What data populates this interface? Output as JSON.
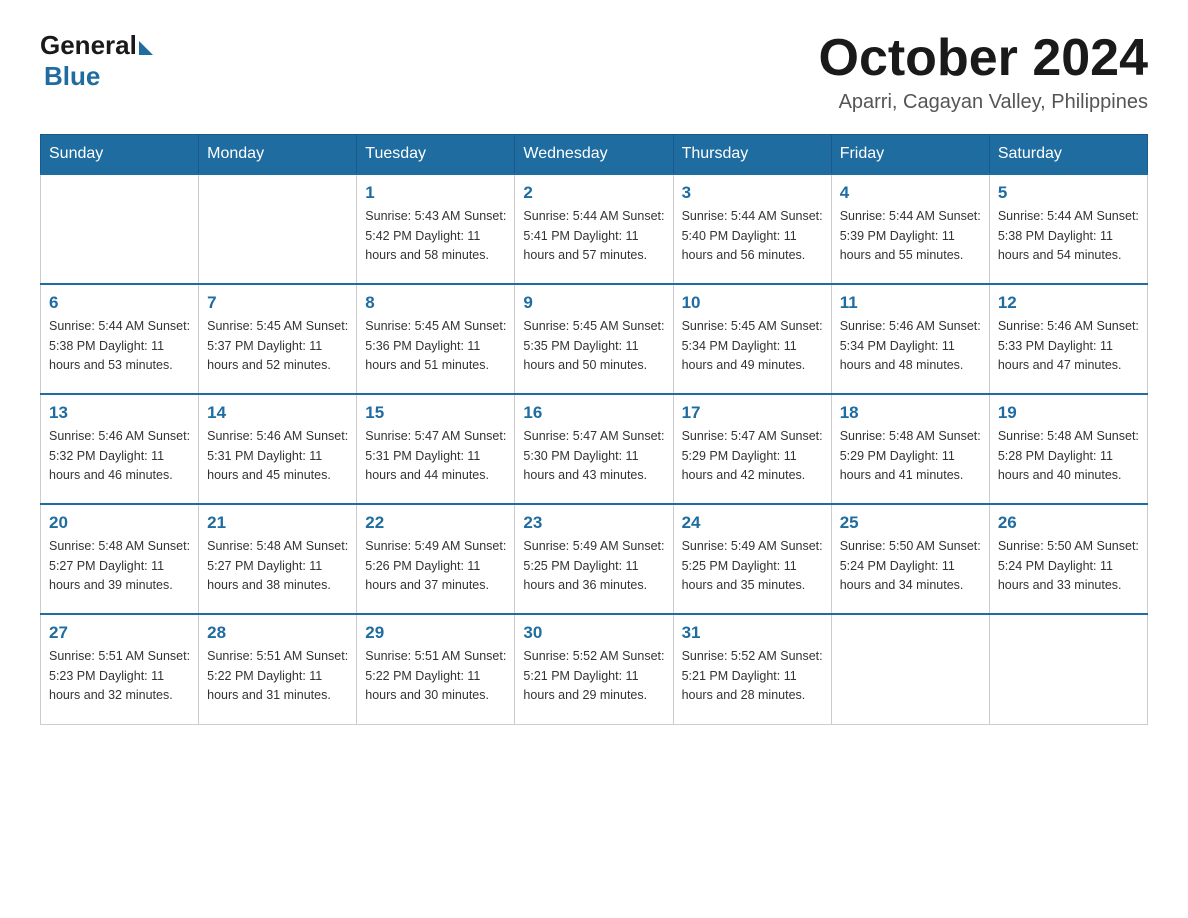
{
  "header": {
    "logo_general": "General",
    "logo_blue": "Blue",
    "month_title": "October 2024",
    "location": "Aparri, Cagayan Valley, Philippines"
  },
  "days_of_week": [
    "Sunday",
    "Monday",
    "Tuesday",
    "Wednesday",
    "Thursday",
    "Friday",
    "Saturday"
  ],
  "weeks": [
    [
      {
        "day": "",
        "info": ""
      },
      {
        "day": "",
        "info": ""
      },
      {
        "day": "1",
        "info": "Sunrise: 5:43 AM\nSunset: 5:42 PM\nDaylight: 11 hours\nand 58 minutes."
      },
      {
        "day": "2",
        "info": "Sunrise: 5:44 AM\nSunset: 5:41 PM\nDaylight: 11 hours\nand 57 minutes."
      },
      {
        "day": "3",
        "info": "Sunrise: 5:44 AM\nSunset: 5:40 PM\nDaylight: 11 hours\nand 56 minutes."
      },
      {
        "day": "4",
        "info": "Sunrise: 5:44 AM\nSunset: 5:39 PM\nDaylight: 11 hours\nand 55 minutes."
      },
      {
        "day": "5",
        "info": "Sunrise: 5:44 AM\nSunset: 5:38 PM\nDaylight: 11 hours\nand 54 minutes."
      }
    ],
    [
      {
        "day": "6",
        "info": "Sunrise: 5:44 AM\nSunset: 5:38 PM\nDaylight: 11 hours\nand 53 minutes."
      },
      {
        "day": "7",
        "info": "Sunrise: 5:45 AM\nSunset: 5:37 PM\nDaylight: 11 hours\nand 52 minutes."
      },
      {
        "day": "8",
        "info": "Sunrise: 5:45 AM\nSunset: 5:36 PM\nDaylight: 11 hours\nand 51 minutes."
      },
      {
        "day": "9",
        "info": "Sunrise: 5:45 AM\nSunset: 5:35 PM\nDaylight: 11 hours\nand 50 minutes."
      },
      {
        "day": "10",
        "info": "Sunrise: 5:45 AM\nSunset: 5:34 PM\nDaylight: 11 hours\nand 49 minutes."
      },
      {
        "day": "11",
        "info": "Sunrise: 5:46 AM\nSunset: 5:34 PM\nDaylight: 11 hours\nand 48 minutes."
      },
      {
        "day": "12",
        "info": "Sunrise: 5:46 AM\nSunset: 5:33 PM\nDaylight: 11 hours\nand 47 minutes."
      }
    ],
    [
      {
        "day": "13",
        "info": "Sunrise: 5:46 AM\nSunset: 5:32 PM\nDaylight: 11 hours\nand 46 minutes."
      },
      {
        "day": "14",
        "info": "Sunrise: 5:46 AM\nSunset: 5:31 PM\nDaylight: 11 hours\nand 45 minutes."
      },
      {
        "day": "15",
        "info": "Sunrise: 5:47 AM\nSunset: 5:31 PM\nDaylight: 11 hours\nand 44 minutes."
      },
      {
        "day": "16",
        "info": "Sunrise: 5:47 AM\nSunset: 5:30 PM\nDaylight: 11 hours\nand 43 minutes."
      },
      {
        "day": "17",
        "info": "Sunrise: 5:47 AM\nSunset: 5:29 PM\nDaylight: 11 hours\nand 42 minutes."
      },
      {
        "day": "18",
        "info": "Sunrise: 5:48 AM\nSunset: 5:29 PM\nDaylight: 11 hours\nand 41 minutes."
      },
      {
        "day": "19",
        "info": "Sunrise: 5:48 AM\nSunset: 5:28 PM\nDaylight: 11 hours\nand 40 minutes."
      }
    ],
    [
      {
        "day": "20",
        "info": "Sunrise: 5:48 AM\nSunset: 5:27 PM\nDaylight: 11 hours\nand 39 minutes."
      },
      {
        "day": "21",
        "info": "Sunrise: 5:48 AM\nSunset: 5:27 PM\nDaylight: 11 hours\nand 38 minutes."
      },
      {
        "day": "22",
        "info": "Sunrise: 5:49 AM\nSunset: 5:26 PM\nDaylight: 11 hours\nand 37 minutes."
      },
      {
        "day": "23",
        "info": "Sunrise: 5:49 AM\nSunset: 5:25 PM\nDaylight: 11 hours\nand 36 minutes."
      },
      {
        "day": "24",
        "info": "Sunrise: 5:49 AM\nSunset: 5:25 PM\nDaylight: 11 hours\nand 35 minutes."
      },
      {
        "day": "25",
        "info": "Sunrise: 5:50 AM\nSunset: 5:24 PM\nDaylight: 11 hours\nand 34 minutes."
      },
      {
        "day": "26",
        "info": "Sunrise: 5:50 AM\nSunset: 5:24 PM\nDaylight: 11 hours\nand 33 minutes."
      }
    ],
    [
      {
        "day": "27",
        "info": "Sunrise: 5:51 AM\nSunset: 5:23 PM\nDaylight: 11 hours\nand 32 minutes."
      },
      {
        "day": "28",
        "info": "Sunrise: 5:51 AM\nSunset: 5:22 PM\nDaylight: 11 hours\nand 31 minutes."
      },
      {
        "day": "29",
        "info": "Sunrise: 5:51 AM\nSunset: 5:22 PM\nDaylight: 11 hours\nand 30 minutes."
      },
      {
        "day": "30",
        "info": "Sunrise: 5:52 AM\nSunset: 5:21 PM\nDaylight: 11 hours\nand 29 minutes."
      },
      {
        "day": "31",
        "info": "Sunrise: 5:52 AM\nSunset: 5:21 PM\nDaylight: 11 hours\nand 28 minutes."
      },
      {
        "day": "",
        "info": ""
      },
      {
        "day": "",
        "info": ""
      }
    ]
  ]
}
